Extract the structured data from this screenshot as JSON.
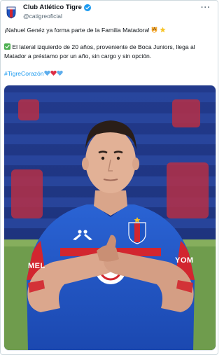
{
  "tweet": {
    "display_name": "Club Atlético Tigre",
    "handle": "@catigreoficial",
    "more_label": "···",
    "line1": "¡Nahuel Genéz ya forma parte de la Familia Matadora!",
    "line2": "El lateral izquierdo de 20 años, proveniente de Boca Juniors, llega al Matador a préstamo por un año, sin cargo y sin opción.",
    "hashtag": "#TigreCorazón",
    "image_texts": {
      "sponsor_left": "MEL",
      "sponsor_right": "YOM"
    }
  },
  "colors": {
    "tigre_blue": "#1f56c4",
    "tigre_red": "#d2262f",
    "link": "#1d9bf0",
    "verified": "#1d9bf0"
  },
  "icons": [
    "club-crest-icon",
    "verified-badge-icon",
    "more-options-icon",
    "tiger-face-emoji-icon",
    "star-emoji-icon",
    "check-mark-emoji-icon",
    "blue-heart-emoji-icon",
    "red-heart-emoji-icon"
  ]
}
